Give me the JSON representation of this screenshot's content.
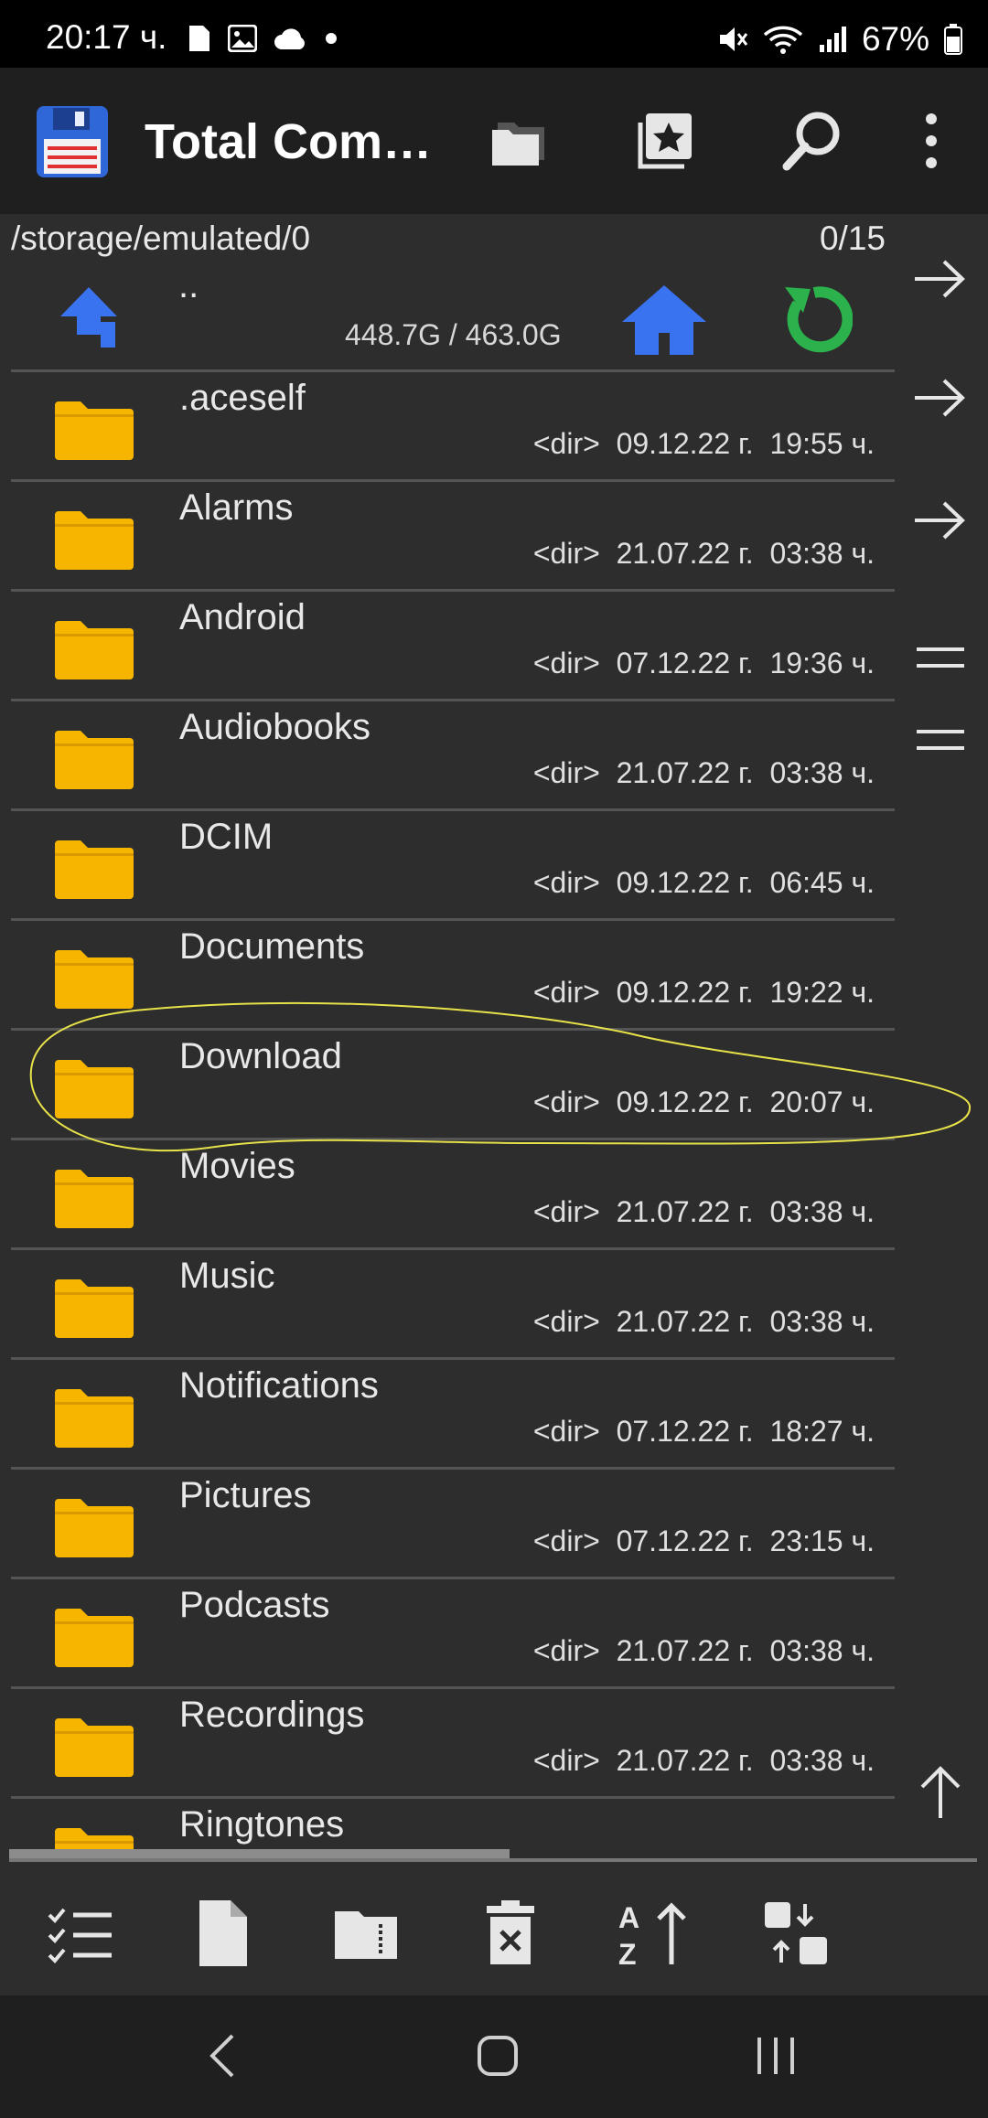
{
  "status_bar": {
    "time": "20:17 ч.",
    "battery": "67%"
  },
  "app_bar": {
    "title": "Total Com…",
    "icons": [
      "floppy-disk-logo",
      "folders-icon",
      "bookmarks-star-icon",
      "search-icon",
      "more-vert-icon"
    ]
  },
  "path": {
    "current": "/storage/emulated/0",
    "count": "0/15"
  },
  "up_row": {
    "label": "..",
    "space": "448.7G / 463.0G"
  },
  "files": [
    {
      "name": ".aceself",
      "meta": "<dir>  09.12.22 г.  19:55 ч."
    },
    {
      "name": "Alarms",
      "meta": "<dir>  21.07.22 г.  03:38 ч."
    },
    {
      "name": "Android",
      "meta": "<dir>  07.12.22 г.  19:36 ч."
    },
    {
      "name": "Audiobooks",
      "meta": "<dir>  21.07.22 г.  03:38 ч."
    },
    {
      "name": "DCIM",
      "meta": "<dir>  09.12.22 г.  06:45 ч."
    },
    {
      "name": "Documents",
      "meta": "<dir>  09.12.22 г.  19:22 ч."
    },
    {
      "name": "Download",
      "meta": "<dir>  09.12.22 г.  20:07 ч."
    },
    {
      "name": "Movies",
      "meta": "<dir>  21.07.22 г.  03:38 ч."
    },
    {
      "name": "Music",
      "meta": "<dir>  21.07.22 г.  03:38 ч."
    },
    {
      "name": "Notifications",
      "meta": "<dir>  07.12.22 г.  18:27 ч."
    },
    {
      "name": "Pictures",
      "meta": "<dir>  07.12.22 г.  23:15 ч."
    },
    {
      "name": "Podcasts",
      "meta": "<dir>  21.07.22 г.  03:38 ч."
    },
    {
      "name": "Recordings",
      "meta": "<dir>  21.07.22 г.  03:38 ч."
    },
    {
      "name": "Ringtones",
      "meta": ""
    }
  ],
  "colors": {
    "folder": "#f7b500",
    "accent_blue": "#3a73f0",
    "accent_green": "#2bb24c",
    "annotation": "#e8e24a"
  },
  "bottom_toolbar": [
    "multi-select-icon",
    "new-file-icon",
    "archive-folder-icon",
    "delete-icon",
    "sort-icon",
    "swap-panels-icon"
  ],
  "nav_bar": [
    "back-icon",
    "home-icon",
    "recents-icon"
  ]
}
